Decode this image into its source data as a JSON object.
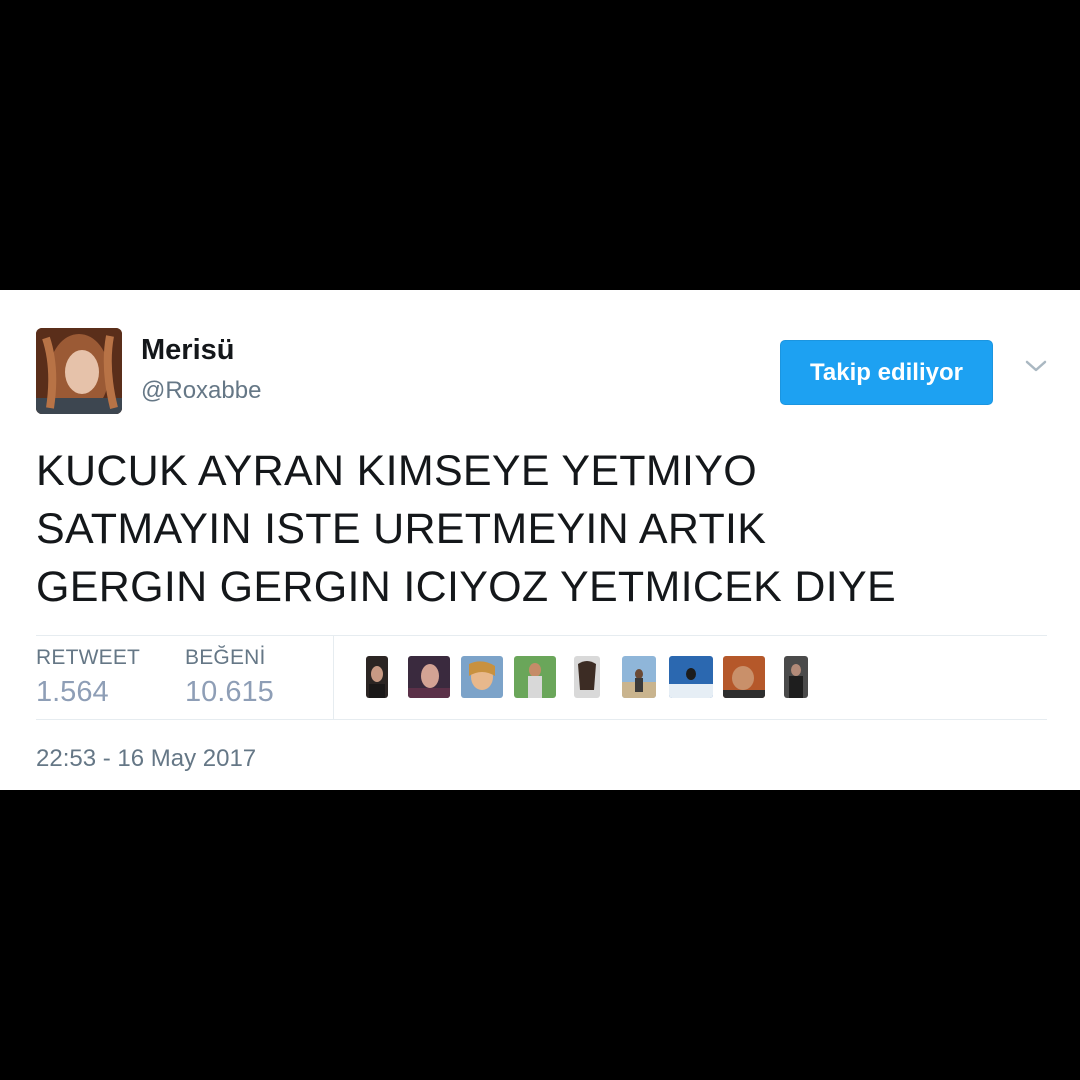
{
  "user": {
    "display_name": "Merisü",
    "handle": "@Roxabbe"
  },
  "follow_button": {
    "label": "Takip ediliyor"
  },
  "menu_icon": "chevron-down-icon",
  "tweet": {
    "lines": [
      "KUCUK AYRAN KIMSEYE YETMIYO",
      "SATMAYIN ISTE URETMEYIN ARTIK",
      "GERGIN GERGIN ICIYOZ YETMICEK DIYE"
    ]
  },
  "stats": {
    "retweet_label": "RETWEET",
    "retweet_count": "1.564",
    "like_label": "BEĞENİ",
    "like_count": "10.615"
  },
  "likers_count_shown": 9,
  "timestamp": "22:53 - 16 May 2017",
  "colors": {
    "accent": "#1da1f2",
    "text_primary": "#14171a",
    "text_secondary": "#657786",
    "stat_value": "#8e9eb6",
    "divider": "#e6ecf0"
  }
}
